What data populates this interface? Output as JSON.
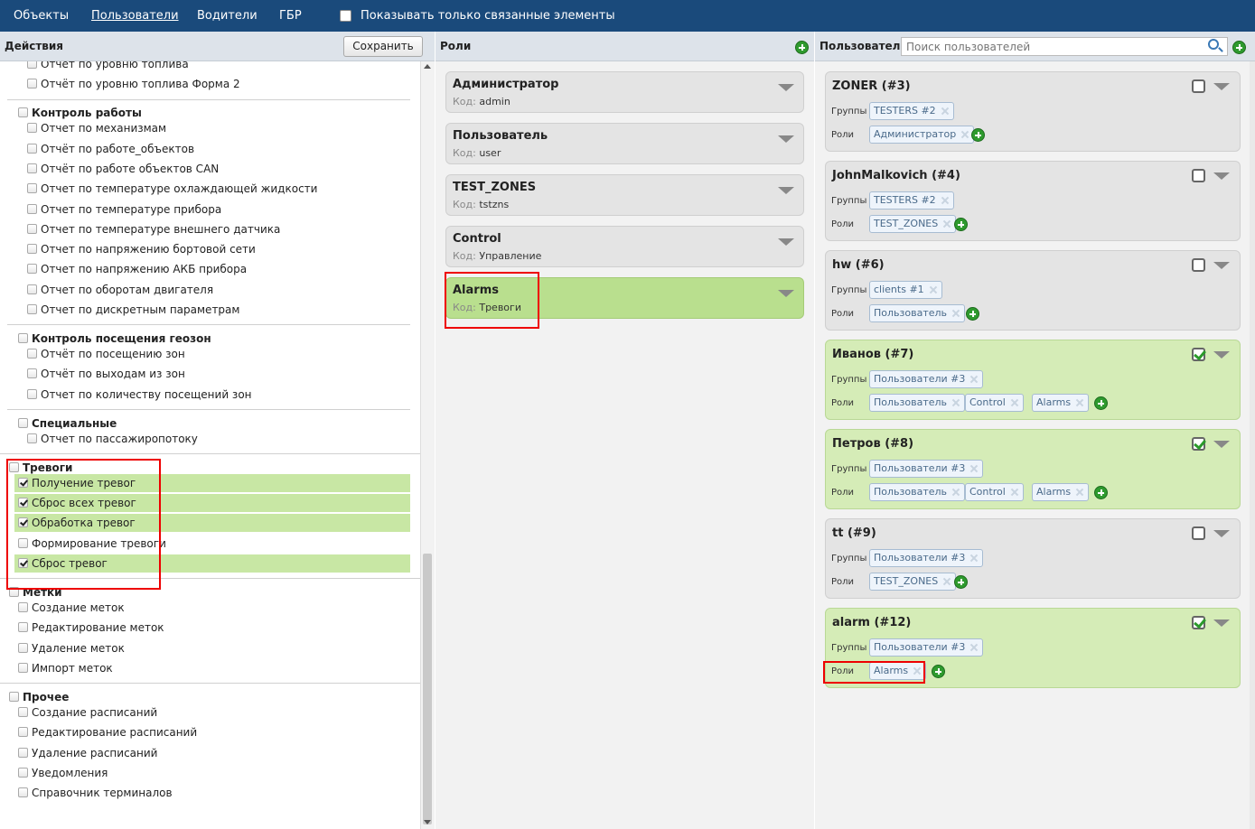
{
  "topnav": {
    "items": [
      "Объекты",
      "Пользователи",
      "Водители",
      "ГБР"
    ],
    "active_index": 1,
    "only_linked_label": "Показывать только связанные элементы",
    "only_linked_checked": false
  },
  "actions": {
    "title": "Действия",
    "save_label": "Сохранить",
    "top_items": [
      "Отчет по уровню топлива",
      "Отчёт по уровню топлива Форма 2"
    ],
    "groups": [
      {
        "name": "Контроль работы",
        "items": [
          "Отчет по механизмам",
          "Отчёт по работе_объектов",
          "Отчёт по работе объектов CAN",
          "Отчет по температуре охлаждающей жидкости",
          "Отчет по температуре прибора",
          "Отчет по температуре внешнего датчика",
          "Отчет по напряжению бортовой сети",
          "Отчет по напряжению АКБ прибора",
          "Отчет по оборотам двигателя",
          "Отчет по дискретным параметрам"
        ]
      },
      {
        "name": "Контроль посещения геозон",
        "items": [
          "Отчёт по посещению зон",
          "Отчёт по выходам из зон",
          "Отчет по количеству посещений зон"
        ]
      },
      {
        "name": "Специальные",
        "items": [
          "Отчет по пассажиропотоку"
        ]
      },
      {
        "name": "Тревоги",
        "items": [
          "Получение тревог",
          "Сброс всех тревог",
          "Обработка тревог",
          "Формирование тревоги",
          "Сброс тревог"
        ],
        "checked": [
          true,
          true,
          true,
          false,
          true
        ]
      },
      {
        "name": "Метки",
        "items": [
          "Создание меток",
          "Редактирование меток",
          "Удаление меток",
          "Импорт меток"
        ]
      },
      {
        "name": "Прочее",
        "items": [
          "Создание расписаний",
          "Редактирование расписаний",
          "Удаление расписаний",
          "Уведомления",
          "Справочник терминалов"
        ]
      }
    ]
  },
  "roles": {
    "title": "Роли",
    "code_label": "Код:",
    "items": [
      {
        "name": "Администратор",
        "code": "admin",
        "active": false
      },
      {
        "name": "Пользователь",
        "code": "user",
        "active": false
      },
      {
        "name": "TEST_ZONES",
        "code": "tstzns",
        "active": false
      },
      {
        "name": "Control",
        "code": "Управление",
        "active": false
      },
      {
        "name": "Alarms",
        "code": "Тревоги",
        "active": true
      }
    ]
  },
  "users": {
    "title": "Пользователи",
    "search_placeholder": "Поиск пользователей",
    "groups_label": "Группы",
    "roles_label": "Роли",
    "items": [
      {
        "name": "ZONER (#3)",
        "checked": false,
        "groups": [
          "TESTERS #2"
        ],
        "roles": [
          "Администратор"
        ]
      },
      {
        "name": "JohnMalkovich (#4)",
        "checked": false,
        "groups": [
          "TESTERS #2"
        ],
        "roles": [
          "TEST_ZONES"
        ]
      },
      {
        "name": "hw (#6)",
        "checked": false,
        "groups": [
          "clients #1"
        ],
        "roles": [
          "Пользователь"
        ]
      },
      {
        "name": "Иванов (#7)",
        "checked": true,
        "groups": [
          "Пользователи #3"
        ],
        "roles": [
          "Пользователь",
          "Control",
          "Alarms"
        ]
      },
      {
        "name": "Петров (#8)",
        "checked": true,
        "groups": [
          "Пользователи #3"
        ],
        "roles": [
          "Пользователь",
          "Control",
          "Alarms"
        ]
      },
      {
        "name": "tt (#9)",
        "checked": false,
        "groups": [
          "Пользователи #3"
        ],
        "roles": [
          "TEST_ZONES"
        ]
      },
      {
        "name": "alarm (#12)",
        "checked": true,
        "groups": [
          "Пользователи #3"
        ],
        "roles": [
          "Alarms"
        ]
      }
    ]
  },
  "colors": {
    "topbar": "#1a4a7b",
    "active_green": "#b9df8e",
    "highlight_red": "#ee0000"
  }
}
